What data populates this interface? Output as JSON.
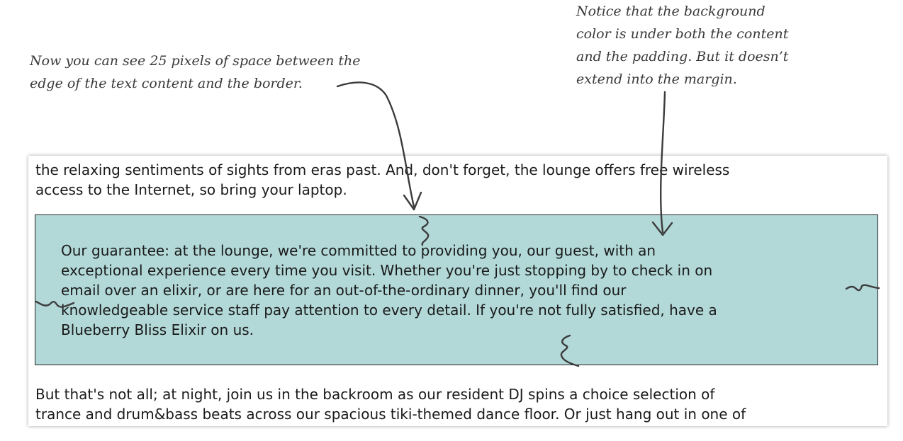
{
  "annotations": {
    "padding_note": [
      "Now you can see 25 pixels of space between the",
      "edge of the text content and the border."
    ],
    "background_note": [
      "Notice that the background",
      "color is under both the content",
      "and the padding. But it doesn’t",
      "extend into the margin."
    ]
  },
  "page": {
    "intro_lines": [
      "the relaxing sentiments of sights from eras past. And, don't forget, the lounge offers free wireless",
      "access to the Internet, so bring your laptop."
    ],
    "guarantee_lines": [
      "Our guarantee: at the lounge, we're committed to providing you, our guest, with an",
      "exceptional experience every time you visit. Whether you're just stopping by to check in on",
      "email over an elixir, or are here for an out-of-the-ordinary dinner, you'll find our",
      "knowledgeable service staff pay attention to every detail. If you're not fully satisfied, have a",
      "Blueberry Bliss Elixir on us."
    ],
    "closing_lines": [
      "But that's not all; at night, join us in the backroom as our resident DJ spins a choice selection of",
      "trance and drum&bass beats across our spacious tiki-themed dance floor. Or just hang out in one of"
    ]
  },
  "colors": {
    "guarantee_background": "#b2d8d8",
    "guarantee_border": "#222222",
    "text": "#1a1a1a",
    "annotation_ink": "#3c3c3c"
  }
}
